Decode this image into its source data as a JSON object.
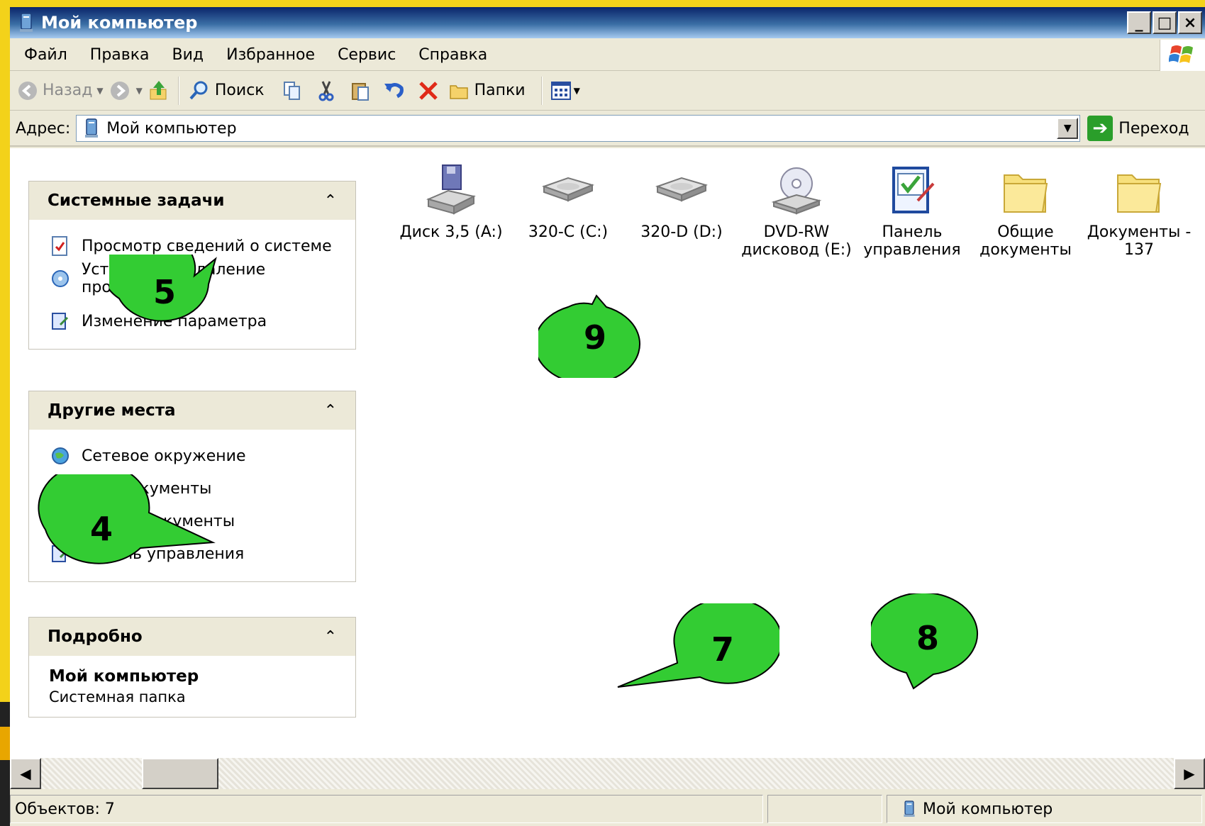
{
  "window": {
    "title": "Мой компьютер",
    "controls": [
      "_",
      "□",
      "×"
    ]
  },
  "menu": {
    "items": [
      "Файл",
      "Правка",
      "Вид",
      "Избранное",
      "Сервис",
      "Справка"
    ]
  },
  "toolbar": {
    "back_label": "Назад",
    "search_label": "Поиск",
    "folders_label": "Папки"
  },
  "address": {
    "label": "Адрес:",
    "value": "Мой компьютер",
    "go_label": "Переход"
  },
  "tasks": {
    "system": {
      "title": "Системные задачи",
      "items": [
        "Просмотр сведений о системе",
        "Установка и удаление программ",
        "Изменение параметра"
      ]
    },
    "places": {
      "title": "Другие места",
      "items": [
        "Сетевое окружение",
        "Мои документы",
        "Общие документы",
        "Панель управления"
      ]
    },
    "details": {
      "title": "Подробно",
      "name": "Мой компьютер",
      "type": "Системная папка"
    }
  },
  "items": [
    {
      "label": "Диск 3,5 (A:)",
      "icon": "floppy-drive-icon"
    },
    {
      "label": "320-C (C:)",
      "icon": "hard-drive-icon"
    },
    {
      "label": "320-D (D:)",
      "icon": "hard-drive-icon"
    },
    {
      "label": "DVD-RW дисковод (E:)",
      "icon": "dvd-drive-icon"
    },
    {
      "label": "Панель управления",
      "icon": "control-panel-icon"
    },
    {
      "label": "Общие документы",
      "icon": "folder-icon"
    },
    {
      "label": "Документы - 137",
      "icon": "folder-icon"
    }
  ],
  "status": {
    "count": "Объектов: 7",
    "location": "Мой компьютер"
  },
  "callouts": [
    "5",
    "9",
    "4",
    "7",
    "8"
  ],
  "colors": {
    "callout_fill": "#33cc33",
    "titlebar": "#0a246a",
    "background": "#f3d21a"
  }
}
